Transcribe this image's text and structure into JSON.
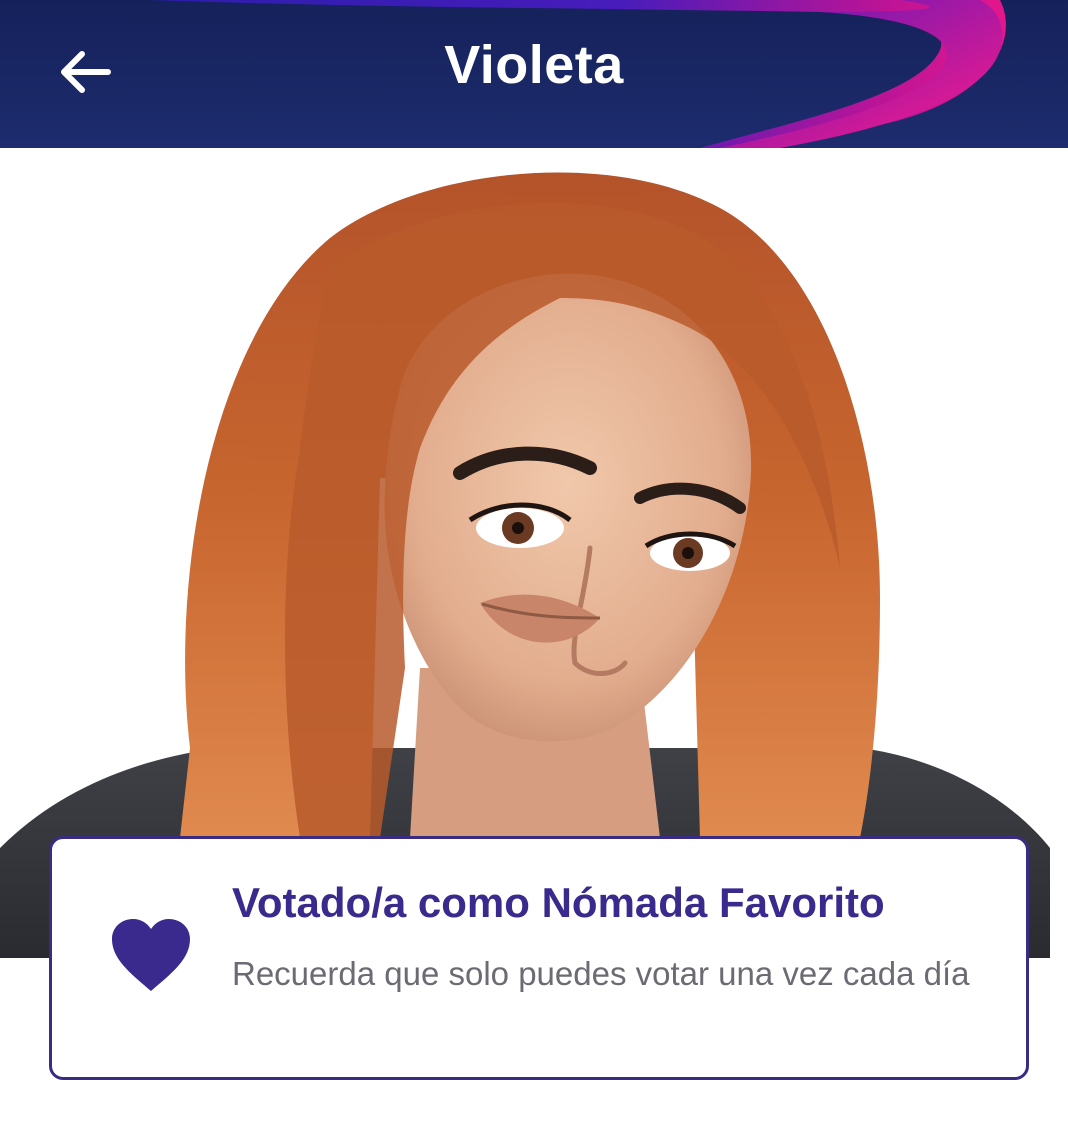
{
  "header": {
    "title": "Violeta",
    "back_icon": "arrow-left-icon",
    "background_color": "#1d2c6e",
    "accent_colors": [
      "#2a1aa8",
      "#e0158f"
    ]
  },
  "photo": {
    "subject": "contestant-portrait"
  },
  "vote_card": {
    "icon": "heart-icon",
    "title": "Votado/a como Nómada Favorito",
    "subtitle": "Recuerda que solo puedes votar una vez cada día",
    "title_color": "#3a2a8e",
    "border_color": "#3b2c83"
  }
}
